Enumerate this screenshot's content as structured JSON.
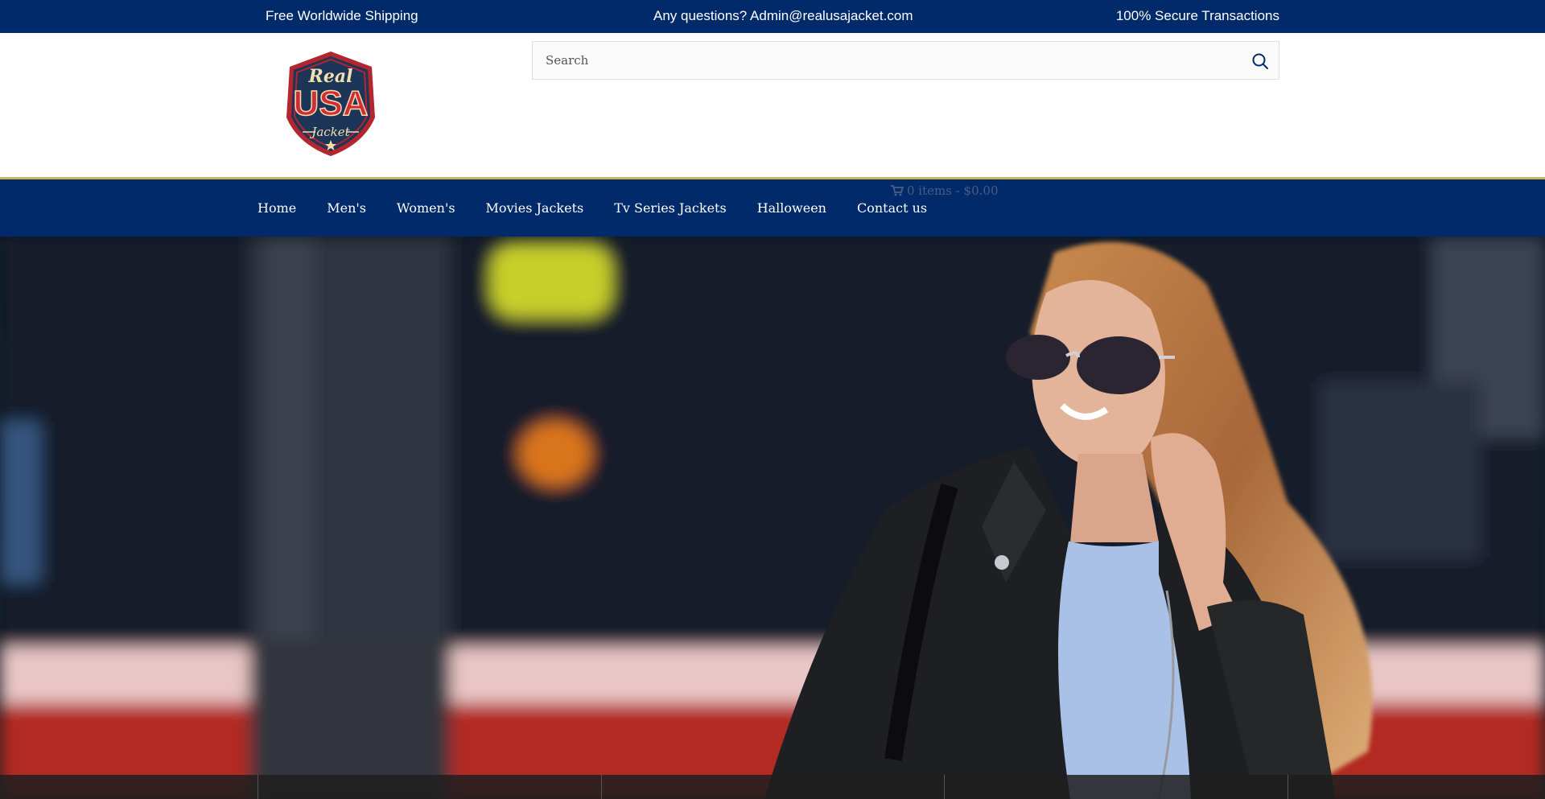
{
  "topbar": {
    "shipping": "Free Worldwide Shipping",
    "questions": "Any questions? Admin@realusajacket.com",
    "secure": "100% Secure Transactions"
  },
  "logo": {
    "line1": "Real",
    "line2": "USA",
    "line3": "Jacket"
  },
  "search": {
    "placeholder": "Search",
    "icon": "search-icon"
  },
  "cart": {
    "icon": "cart-icon",
    "text": "0 items - $0.00"
  },
  "nav": {
    "items": [
      {
        "label": "Home"
      },
      {
        "label": "Men's"
      },
      {
        "label": "Women's"
      },
      {
        "label": "Movies Jackets"
      },
      {
        "label": "Tv Series Jackets"
      },
      {
        "label": "Halloween"
      },
      {
        "label": "Contact us"
      }
    ]
  },
  "colors": {
    "navy": "#012a6b",
    "gold": "#c8b25a",
    "logo_red": "#b3262f",
    "logo_navy": "#1d3557",
    "logo_cream": "#f1dfb0"
  }
}
